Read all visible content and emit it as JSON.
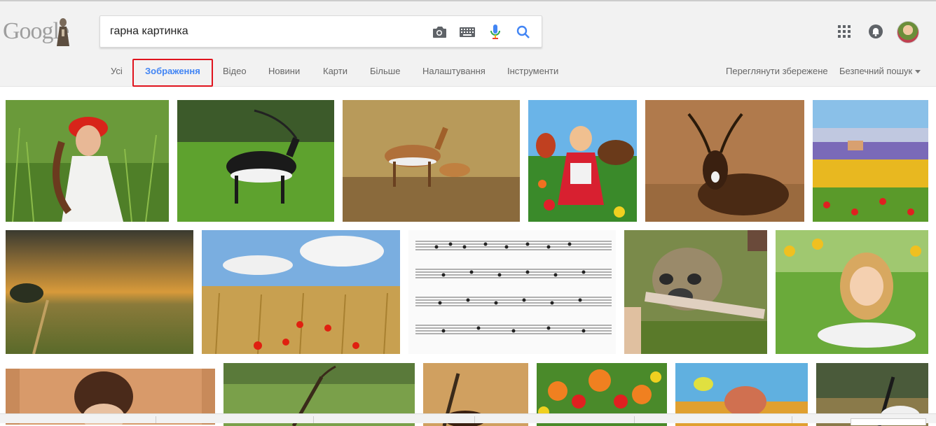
{
  "search": {
    "query": "гарна картинка"
  },
  "logo": {
    "text": "Google"
  },
  "tabs": [
    {
      "label": "Усі"
    },
    {
      "label": "Зображення"
    },
    {
      "label": "Відео"
    },
    {
      "label": "Новини"
    },
    {
      "label": "Карти"
    },
    {
      "label": "Більше"
    },
    {
      "label": "Налаштування"
    },
    {
      "label": "Інструменти"
    }
  ],
  "right_links": {
    "saved": "Переглянути збережене",
    "safe_search": "Безпечний пошук"
  },
  "colors": {
    "accent": "#4285f4",
    "highlight": "#e0141e"
  },
  "icons": [
    "camera-icon",
    "keyboard-icon",
    "mic-icon",
    "search-icon",
    "apps-icon",
    "notifications-icon",
    "avatar"
  ]
}
